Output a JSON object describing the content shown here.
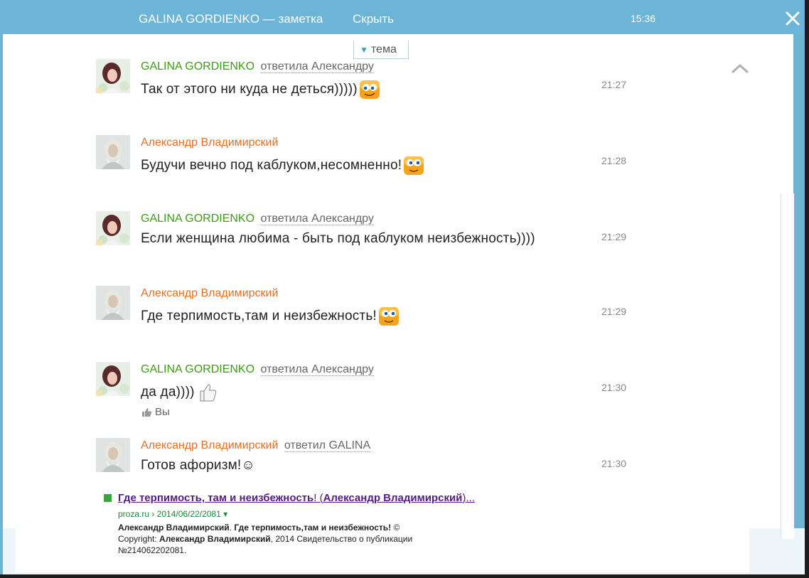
{
  "window": {
    "title": "GALINA GORDIENKO — заметка",
    "hide_label": "Скрыть",
    "time": "15:36",
    "topic_label": "тема"
  },
  "messages": [
    {
      "author": "GALINA GORDIENKO",
      "author_color": "#3f9a16",
      "reply": "ответила Александру",
      "text": "Так от этого ни куда не деться)))))",
      "emoji": "wink-emoji",
      "time": "21:27"
    },
    {
      "author": "Александр Владимирский",
      "author_color": "#e07027",
      "reply": "",
      "text": "Будучи вечно под каблуком,несомненно!",
      "emoji": "googly-eyes-emoji",
      "time": "21:28"
    },
    {
      "author": "GALINA GORDIENKO",
      "author_color": "#3f9a16",
      "reply": "ответила Александру",
      "text": "Если женщина любима - быть под каблуком неизбежность))))",
      "emoji": "",
      "time": "21:29"
    },
    {
      "author": "Александр Владимирский",
      "author_color": "#e07027",
      "reply": "",
      "text": "Где терпимость,там и неизбежность!",
      "emoji": "googly-eyes-emoji",
      "time": "21:29"
    },
    {
      "author": "GALINA GORDIENKO",
      "author_color": "#3f9a16",
      "reply": "ответила Александру",
      "text": "да да))))",
      "emoji": "thumbs-up-emoji",
      "time": "21:30",
      "like_label": "Вы"
    },
    {
      "author": "Александр Владимирский",
      "author_color": "#e07027",
      "reply": "ответил GALINA",
      "text": "Готов афоризм!☺",
      "emoji": "",
      "time": "21:30"
    }
  ],
  "snippet": {
    "title_main": "Где терпимость, там и неизбежность",
    "title_mid": "! (",
    "title_author": "Александр Владимирский",
    "title_end": ")...",
    "url": "proza.ru › 2014/06/22/2081 ▾",
    "line1_bold1": "Александр Владимирский",
    "line1_sep": ". ",
    "line1_bold2": "Где терпимость,там и неизбежность!",
    "line1_rest": " ©",
    "line2_pre": "Copyright: ",
    "line2_bold": "Александр Владимирский",
    "line2_rest": ", 2014 Свидетельство о публикации",
    "line3": "№214062202081."
  }
}
